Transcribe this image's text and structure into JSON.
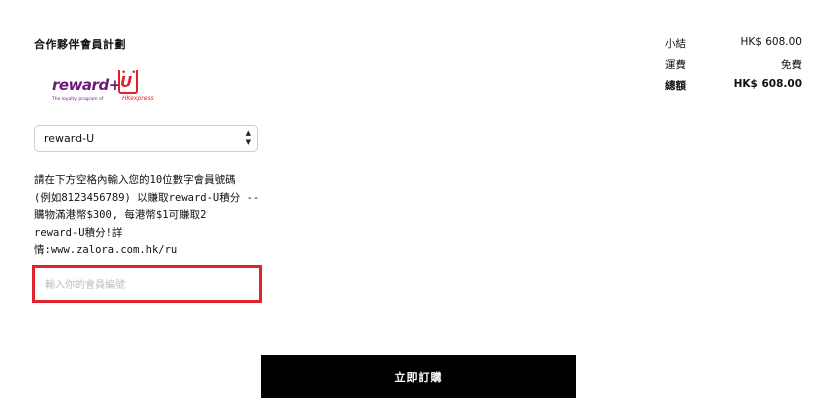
{
  "partner": {
    "title": "合作夥伴會員計劃",
    "logo": {
      "brand": "reward+",
      "u": "U",
      "tagline": "The loyalty program of",
      "hk": "HKexpress"
    },
    "select": {
      "value": "reward-U"
    },
    "description_lines": [
      "請在下方空格內輸入您的10位數字會員號碼",
      "(例如8123456789) 以賺取reward-U積分 --",
      "購物滿港幣$300, 每港幣$1可賺取2",
      "reward-U積分!詳",
      "情:www.zalora.com.hk/ru"
    ],
    "member_input": {
      "placeholder": "輸入你的會員編號",
      "value": ""
    }
  },
  "summary": {
    "subtotal_label": "小結",
    "subtotal_value": "HK$ 608.00",
    "shipping_label": "運費",
    "shipping_value": "免費",
    "total_label": "總額",
    "total_value": "HK$ 608.00"
  },
  "submit_label": "立即訂購",
  "colors": {
    "highlight": "#e0232e",
    "button_bg": "#000000",
    "brand_purple": "#6a1b7a"
  }
}
